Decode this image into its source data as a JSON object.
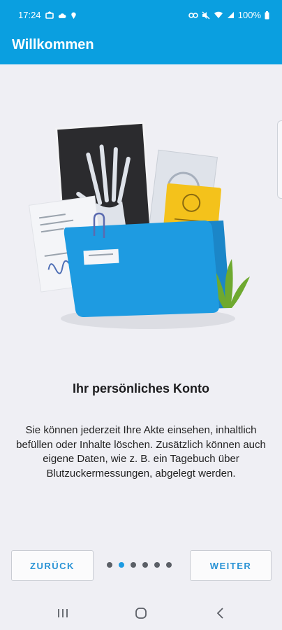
{
  "status_bar": {
    "time": "17:24",
    "battery": "100%",
    "left_icons": [
      "notification-icon",
      "cloud-icon",
      "location-pin-icon"
    ],
    "right_icons": [
      "link-icon",
      "mute-icon",
      "wifi-icon",
      "signal-icon",
      "battery-icon"
    ]
  },
  "app_bar": {
    "title": "Willkommen"
  },
  "page": {
    "heading": "Ihr persönliches Konto",
    "body": "Sie können jederzeit Ihre Akte einsehen, inhaltlich befüllen oder Inhalte löschen. Zusätzlich können auch eigene Daten, wie z. B. ein Tagebuch über Blutzuckermessungen, abgelegt werden."
  },
  "pager": {
    "total": 6,
    "active_index": 1
  },
  "buttons": {
    "back": "ZURÜCK",
    "next": "WEITER"
  },
  "colors": {
    "primary": "#0a9fe0",
    "accent": "#2a93d5",
    "background": "#efeff4"
  },
  "nav_bar": {
    "icons": [
      "recent-apps-icon",
      "home-icon",
      "back-icon"
    ]
  }
}
